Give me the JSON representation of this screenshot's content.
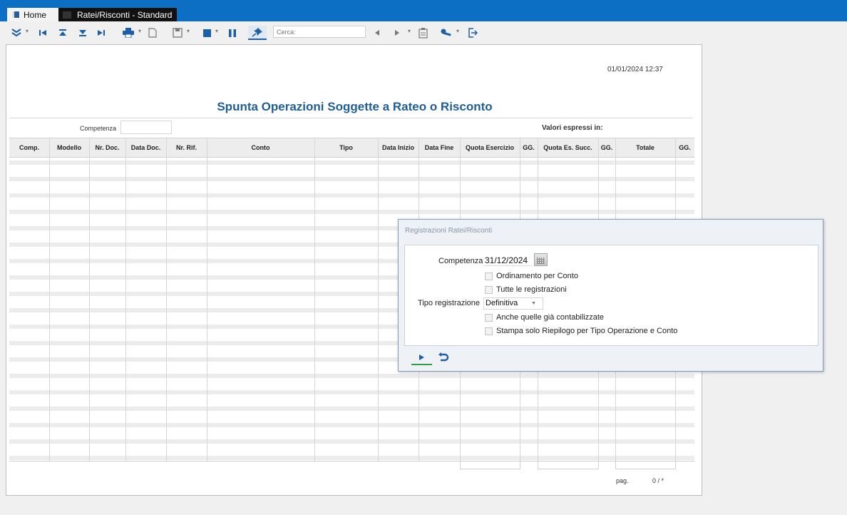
{
  "tabs": {
    "home": "Home",
    "document": "Ratei/Risconti - Standard"
  },
  "toolbar": {
    "search_placeholder": "Cerca:",
    "icons": [
      "expand-icon",
      "first-record-icon",
      "move-top-icon",
      "move-bottom-icon",
      "last-record-icon",
      "print-icon",
      "page-icon",
      "save-icon",
      "stop-icon",
      "pause-icon",
      "pin-icon",
      "prev-icon",
      "next-icon",
      "clipboard-icon",
      "wrench-icon",
      "exit-icon"
    ]
  },
  "report": {
    "timestamp": "01/01/2024 12:37",
    "title": "Spunta Operazioni Soggette a Rateo o Risconto",
    "competenza_label": "Competenza",
    "valori_label": "Valori espressi in:",
    "columns": [
      "Comp.",
      "Modello",
      "Nr. Doc.",
      "Data Doc.",
      "Nr. Rif.",
      "Conto",
      "Tipo",
      "Data Inizio",
      "Data Fine",
      "Quota Esercizio",
      "GG.",
      "Quota Es. Succ.",
      "GG.",
      "Totale",
      "GG."
    ],
    "page_label": "pag.",
    "page_value": "0 / *"
  },
  "dialog": {
    "title": "Registrazioni Ratei/Risconti",
    "competenza_label": "Competenza",
    "competenza_value": "31/12/2024",
    "checkbox_ordinamento": "Ordinamento per Conto",
    "checkbox_tutte": "Tutte le registrazioni",
    "tipo_label": "Tipo registrazione",
    "tipo_value": "Definitiva",
    "checkbox_anche": "Anche quelle già contabilizzate",
    "checkbox_stampa": "Stampa solo Riepilogo per Tipo Operazione e Conto"
  },
  "colors": {
    "topbar": "#0c6fc4",
    "accent": "#1a5fa8",
    "title": "#1f5e99",
    "run_underline": "#2f9d46"
  }
}
